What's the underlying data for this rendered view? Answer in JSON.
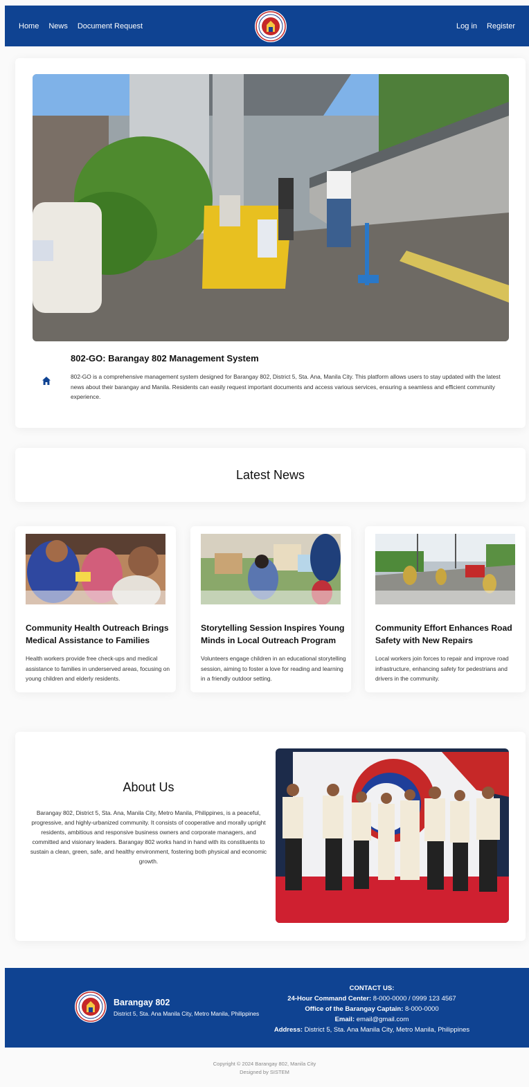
{
  "nav": {
    "home": "Home",
    "news": "News",
    "document_request": "Document Request",
    "login": "Log in",
    "register": "Register"
  },
  "hero": {
    "title": "802-GO: Barangay 802 Management System",
    "description": "802-GO is a comprehensive management system designed for Barangay 802, District 5, Sta. Ana, Manila City. This platform allows users to stay updated with the latest news about their barangay and Manila. Residents can easily request important documents and access various services, ensuring a seamless and efficient community experience."
  },
  "latest_news": {
    "heading": "Latest News",
    "items": [
      {
        "title": "Community Health Outreach Brings Medical Assistance to Families",
        "description": "Health workers provide free check-ups and medical assistance to families in underserved areas, focusing on young children and elderly residents."
      },
      {
        "title": "Storytelling Session Inspires Young Minds in Local Outreach Program",
        "description": "Volunteers engage children in an educational storytelling session, aiming to foster a love for reading and learning in a friendly outdoor setting."
      },
      {
        "title": "Community Effort Enhances Road Safety with New Repairs",
        "description": "Local workers join forces to repair and improve road infrastructure, enhancing safety for pedestrians and drivers in the community."
      }
    ]
  },
  "about": {
    "heading": "About Us",
    "text": "Barangay 802, District 5, Sta. Ana, Manila City, Metro Manila, Philippines, is a peaceful, progressive, and highly-urbanized community. It consists of cooperative and morally upright residents, ambitious and responsive business owners and corporate managers, and committed and visionary leaders. Barangay 802 works hand in hand with its constituents to sustain a clean, green, safe, and healthy environment, fostering both physical and economic growth."
  },
  "footer": {
    "name": "Barangay 802",
    "address": "District 5, Sta. Ana Manila City, Metro Manila, Philippines",
    "contact_heading": "CONTACT US:",
    "command_label": "24-Hour Command Center:",
    "command_value": "8-000-0000 / 0999 123 4567",
    "captain_label": "Office of the Barangay Captain:",
    "captain_value": "8-000-0000",
    "email_label": "Email:",
    "email_value": "email@gmail.com",
    "address_label": "Address:",
    "address_value": "District 5, Sta. Ana Manila City, Metro Manila, Philippines",
    "copyright": "Copyright © 2024 Barangay 802, Manila City",
    "designed_by": "Designed by SISTEM"
  },
  "colors": {
    "primary": "#0f4392",
    "background": "#fafafa"
  },
  "icons": {
    "home": "house-icon",
    "logo": "barangay-seal"
  }
}
